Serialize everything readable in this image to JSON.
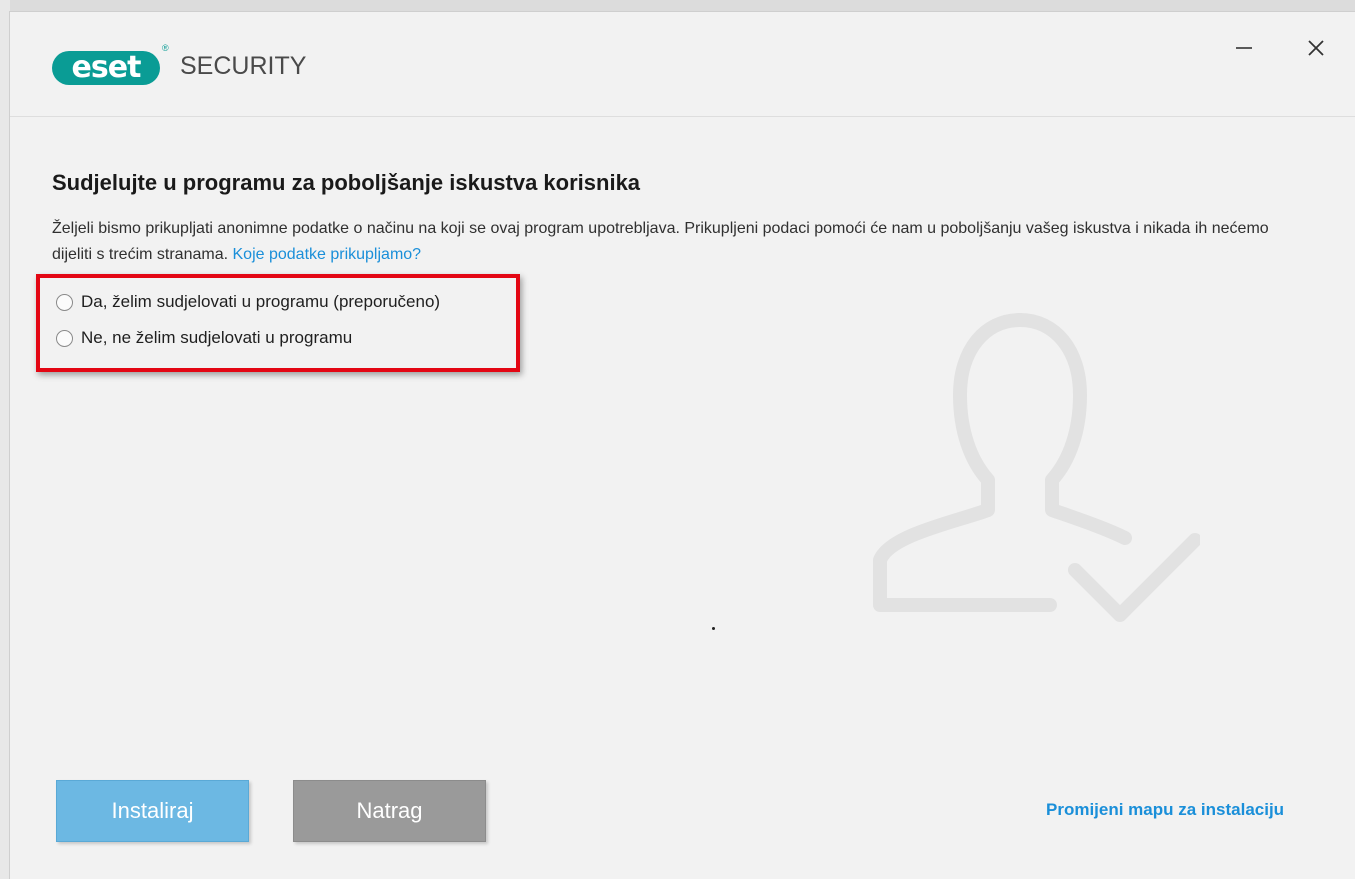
{
  "window": {
    "product_name": "SECURITY",
    "logo_text": "eset",
    "logo_reg": "®",
    "minimize_icon": "minimize-icon",
    "close_icon": "close-icon"
  },
  "page": {
    "heading": "Sudjelujte u programu za poboljšanje iskustva korisnika",
    "description": "Željeli bismo prikupljati anonimne podatke o načinu na koji se ovaj program upotrebljava. Prikupljeni podaci pomoći će nam u poboljšanju vašeg iskustva i nikada ih nećemo dijeliti s trećim stranama.",
    "learn_more_link": "Koje podatke prikupljamo?"
  },
  "options": [
    {
      "label": "Da, želim sudjelovati u programu (preporučeno)",
      "selected": false
    },
    {
      "label": "Ne, ne želim sudjelovati u programu",
      "selected": false
    }
  ],
  "buttons": {
    "install": "Instaliraj",
    "back": "Natrag",
    "change_folder": "Promijeni mapu za instalaciju"
  },
  "colors": {
    "brand": "#0a9c95",
    "link": "#1a8fd9",
    "highlight": "#e30613",
    "install_button": "#6cb8e3",
    "back_button": "#9a9a9a"
  },
  "illustration": "user-check-icon"
}
